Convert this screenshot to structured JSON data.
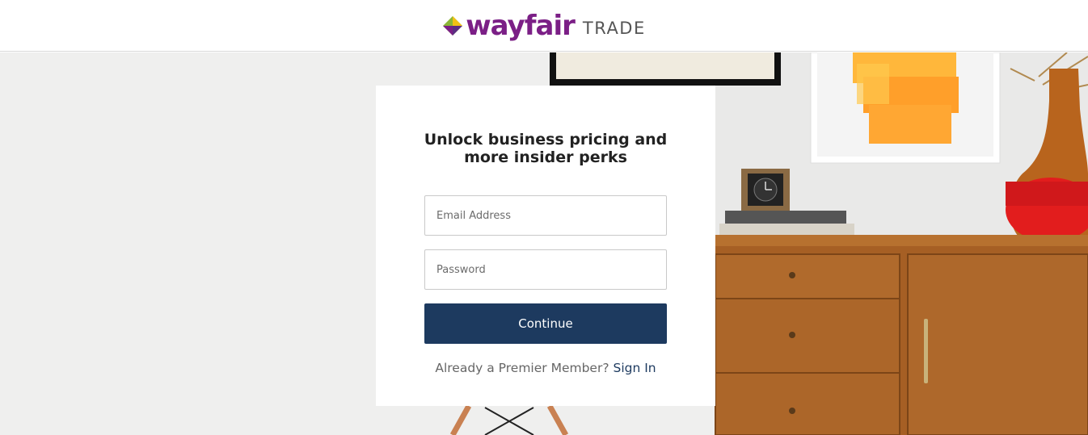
{
  "header": {
    "logo_word": "wayfair",
    "logo_trade": "TRADE"
  },
  "signup": {
    "headline_line1": "Unlock business pricing and",
    "headline_line2": "more insider perks",
    "email_placeholder": "Email Address",
    "password_placeholder": "Password",
    "continue_label": "Continue",
    "member_prompt": "Already a Premier Member?",
    "signin_label": "Sign In"
  },
  "colors": {
    "brand_purple": "#7b1f86",
    "button_navy": "#1d3a5f",
    "card_bg": "#ffffff"
  },
  "icons": {
    "logo_mark": "wayfair-pinwheel-icon"
  }
}
